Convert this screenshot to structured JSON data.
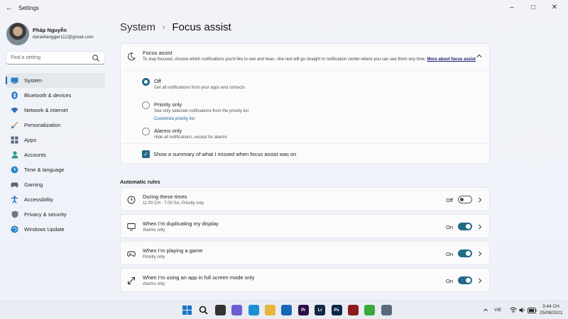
{
  "window": {
    "title": "Settings"
  },
  "user": {
    "name": "Pháp Nguyễn",
    "email": "daniellangger112@gmail.com"
  },
  "search": {
    "placeholder": "Find a setting"
  },
  "nav": [
    {
      "label": "System",
      "icon": "system-icon",
      "active": true
    },
    {
      "label": "Bluetooth & devices",
      "icon": "bluetooth-icon"
    },
    {
      "label": "Network & internet",
      "icon": "wifi-icon"
    },
    {
      "label": "Personalization",
      "icon": "brush-icon"
    },
    {
      "label": "Apps",
      "icon": "apps-icon"
    },
    {
      "label": "Accounts",
      "icon": "person-icon"
    },
    {
      "label": "Time & language",
      "icon": "globe-clock-icon"
    },
    {
      "label": "Gaming",
      "icon": "gamepad-icon"
    },
    {
      "label": "Accessibility",
      "icon": "accessibility-icon"
    },
    {
      "label": "Privacy & security",
      "icon": "shield-icon"
    },
    {
      "label": "Windows Update",
      "icon": "update-icon"
    }
  ],
  "breadcrumb": {
    "root": "System",
    "separator": "›",
    "current": "Focus assist"
  },
  "focus_assist": {
    "title": "Focus assist",
    "description": "To stay focused, choose which notifications you'd like to see and hear—the rest will go straight to notification center where you can see them any time.",
    "more_link": "More about focus assist",
    "options": [
      {
        "label": "Off",
        "sub": "Get all notifications from your apps and contacts",
        "selected": true
      },
      {
        "label": "Priority only",
        "sub": "See only selected notifications from the priority list",
        "link": "Customize priority list",
        "selected": false
      },
      {
        "label": "Alarms only",
        "sub": "Hide all notifications, except for alarms",
        "selected": false
      }
    ],
    "summary_label": "Show a summary of what I missed when focus assist was on",
    "summary_checked": true
  },
  "automatic_rules": {
    "title": "Automatic rules",
    "rules": [
      {
        "title": "During these times",
        "sub": "11:00 CH - 7:00 SA; Priority only",
        "state": "Off",
        "on": false,
        "icon": "clock-icon"
      },
      {
        "title": "When I'm duplicating my display",
        "sub": "Alarms only",
        "state": "On",
        "on": true,
        "icon": "monitor-icon"
      },
      {
        "title": "When I'm playing a game",
        "sub": "Priority only",
        "state": "On",
        "on": true,
        "icon": "gamepad-icon"
      },
      {
        "title": "When I'm using an app in full screen mode only",
        "sub": "Alarms only",
        "state": "On",
        "on": true,
        "icon": "fullscreen-icon"
      }
    ]
  },
  "taskbar": {
    "apps": [
      {
        "name": "start",
        "color": "#1a73c9",
        "label": ""
      },
      {
        "name": "search",
        "color": "#222222",
        "label": ""
      },
      {
        "name": "task-view",
        "color": "#333333",
        "label": ""
      },
      {
        "name": "chat",
        "color": "#6b5fd3",
        "label": ""
      },
      {
        "name": "edge",
        "color": "#1b8fd1",
        "label": ""
      },
      {
        "name": "file-explorer",
        "color": "#e6b53a",
        "label": ""
      },
      {
        "name": "mail",
        "color": "#1667b8",
        "label": ""
      },
      {
        "name": "premiere",
        "color": "#2a0f4a",
        "label": "Pr"
      },
      {
        "name": "lightroom",
        "color": "#0f2740",
        "label": "Lr"
      },
      {
        "name": "photoshop",
        "color": "#0b2747",
        "label": "Ps"
      },
      {
        "name": "red-app",
        "color": "#8d1b1b",
        "label": ""
      },
      {
        "name": "green-app",
        "color": "#3ba83b",
        "label": ""
      },
      {
        "name": "settings",
        "color": "#5a6a7c",
        "label": ""
      }
    ],
    "lang": "VIE",
    "time": "3:44 CH",
    "date": "25/08/2021"
  }
}
